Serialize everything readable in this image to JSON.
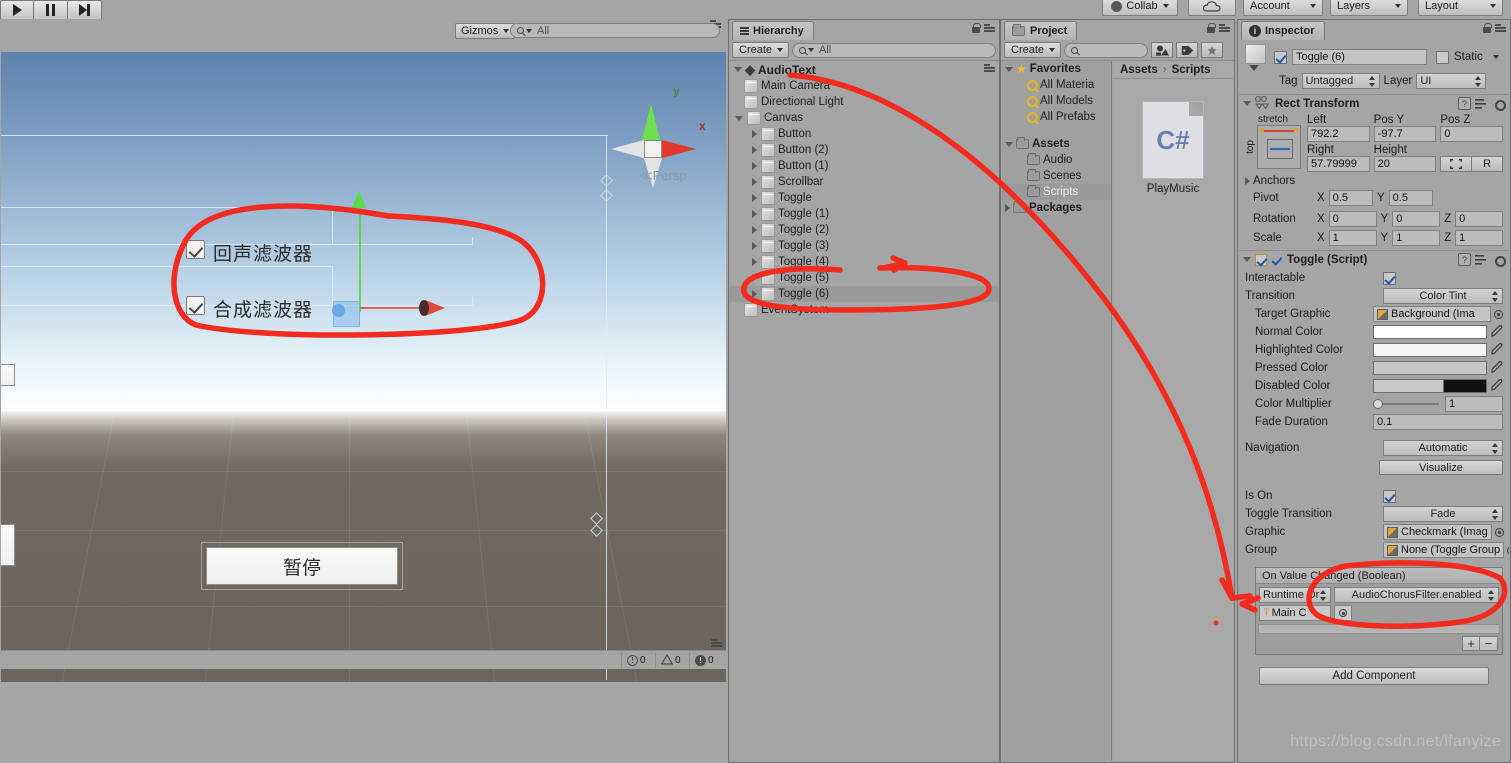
{
  "app": {
    "watermark": "https://blog.csdn.net/lfanyize"
  },
  "toolbar": {
    "collab_label": "Collab",
    "cloud_label": "cloud-icon",
    "account_label": "Account",
    "layers_label": "Layers",
    "layout_label": "Layout",
    "play_label": "play-icon",
    "pause_label": "pause-icon",
    "step_label": "step-icon"
  },
  "scene": {
    "gizmos_label": "Gizmos",
    "search_value": "All",
    "persp_label": "Persp",
    "axis_x": "x",
    "axis_y": "y",
    "ui_labels": [
      "回声滤波器",
      "合成滤波器"
    ],
    "button_label": "暂停",
    "console": {
      "info": "0",
      "warning": "0",
      "error": "0"
    }
  },
  "hierarchy": {
    "tab": "Hierarchy",
    "create_label": "Create",
    "search_value": "All",
    "scene_name": "AudioText",
    "items": [
      {
        "label": "Main Camera",
        "depth": 1,
        "expandable": false,
        "selected": false
      },
      {
        "label": "Directional Light",
        "depth": 1,
        "expandable": false,
        "selected": false
      },
      {
        "label": "Canvas",
        "depth": 1,
        "expandable": true,
        "expanded": true,
        "selected": false
      },
      {
        "label": "Button",
        "depth": 2,
        "expandable": true,
        "selected": false
      },
      {
        "label": "Button (2)",
        "depth": 2,
        "expandable": true,
        "selected": false
      },
      {
        "label": "Button (1)",
        "depth": 2,
        "expandable": true,
        "selected": false
      },
      {
        "label": "Scrollbar",
        "depth": 2,
        "expandable": true,
        "selected": false
      },
      {
        "label": "Toggle",
        "depth": 2,
        "expandable": true,
        "selected": false
      },
      {
        "label": "Toggle (1)",
        "depth": 2,
        "expandable": true,
        "selected": false
      },
      {
        "label": "Toggle (2)",
        "depth": 2,
        "expandable": true,
        "selected": false
      },
      {
        "label": "Toggle (3)",
        "depth": 2,
        "expandable": true,
        "selected": false
      },
      {
        "label": "Toggle (4)",
        "depth": 2,
        "expandable": true,
        "selected": false
      },
      {
        "label": "Toggle (5)",
        "depth": 2,
        "expandable": true,
        "selected": false
      },
      {
        "label": "Toggle (6)",
        "depth": 2,
        "expandable": true,
        "selected": true
      },
      {
        "label": "EventSystem",
        "depth": 1,
        "expandable": false,
        "selected": false
      }
    ]
  },
  "project": {
    "tab": "Project",
    "create_label": "Create",
    "search_value": "",
    "breadcrumb": [
      "Assets",
      "Scripts"
    ],
    "tree": [
      {
        "label": "Favorites",
        "type": "star",
        "depth": 0,
        "expanded": true,
        "bold": true
      },
      {
        "label": "All Materia",
        "type": "lens",
        "depth": 1,
        "bold": false
      },
      {
        "label": "All Models",
        "type": "lens",
        "depth": 1,
        "bold": false
      },
      {
        "label": "All Prefabs",
        "type": "lens",
        "depth": 1,
        "bold": false
      },
      {
        "label": "Assets",
        "type": "folder",
        "depth": 0,
        "expanded": true,
        "bold": true
      },
      {
        "label": "Audio",
        "type": "folder",
        "depth": 1,
        "bold": false
      },
      {
        "label": "Scenes",
        "type": "folder",
        "depth": 1,
        "bold": false
      },
      {
        "label": "Scripts",
        "type": "folder",
        "depth": 1,
        "bold": false,
        "selected": true
      },
      {
        "label": "Packages",
        "type": "folder",
        "depth": 0,
        "expanded": false,
        "bold": true
      }
    ],
    "asset": {
      "name": "PlayMusic",
      "kind": "C#"
    }
  },
  "inspector": {
    "tab": "Inspector",
    "object_name": "Toggle (6)",
    "object_enabled": true,
    "static_label": "Static",
    "static_checked": false,
    "tag_label": "Tag",
    "tag_value": "Untagged",
    "layer_label": "Layer",
    "layer_value": "UI",
    "rect_transform": {
      "title": "Rect Transform",
      "anchor_preset": "stretch",
      "anchor_side": "top",
      "fields": [
        {
          "label": "Left",
          "value": "792.2"
        },
        {
          "label": "Pos Y",
          "value": "-97.7"
        },
        {
          "label": "Pos Z",
          "value": "0"
        },
        {
          "label": "Right",
          "value": "57.79999"
        },
        {
          "label": "Height",
          "value": "20"
        }
      ],
      "blueprint_label": "blueprint-icon",
      "raw_label": "R",
      "anchors_label": "Anchors",
      "pivot_label": "Pivot",
      "pivot_x": "0.5",
      "pivot_y": "0.5",
      "rotation_label": "Rotation",
      "rotation": [
        "0",
        "0",
        "0"
      ],
      "scale_label": "Scale",
      "scale": [
        "1",
        "1",
        "1"
      ],
      "axis_labels": [
        "X",
        "Y",
        "Z"
      ]
    },
    "toggle_script": {
      "title": "Toggle (Script)",
      "enabled": true,
      "rows": [
        {
          "label": "Interactable",
          "kind": "checkbox",
          "value": true
        },
        {
          "label": "Transition",
          "kind": "popup",
          "value": "Color Tint"
        },
        {
          "label": "Target Graphic",
          "kind": "object",
          "value": "Background (Ima"
        },
        {
          "label": "Normal Color",
          "kind": "color",
          "value": "#ffffff"
        },
        {
          "label": "Highlighted Color",
          "kind": "color",
          "value": "#f5f5f5"
        },
        {
          "label": "Pressed Color",
          "kind": "color",
          "value": "#c8c8c8"
        },
        {
          "label": "Disabled Color",
          "kind": "color",
          "value": "#c8c8c8"
        },
        {
          "label": "Color Multiplier",
          "kind": "slider",
          "value": "1"
        },
        {
          "label": "Fade Duration",
          "kind": "text",
          "value": "0.1"
        },
        {
          "label": "Navigation",
          "kind": "popup",
          "value": "Automatic"
        }
      ],
      "visualize_label": "Visualize",
      "rows2": [
        {
          "label": "Is On",
          "kind": "checkbox",
          "value": true
        },
        {
          "label": "Toggle Transition",
          "kind": "popup",
          "value": "Fade"
        },
        {
          "label": "Graphic",
          "kind": "object",
          "value": "Checkmark (Imag"
        },
        {
          "label": "Group",
          "kind": "object",
          "value": "None (Toggle Group"
        }
      ],
      "event": {
        "title": "On Value Changed (Boolean)",
        "mode": "Runtime Or",
        "method": "AudioChorusFilter.enabled",
        "target": "Main C",
        "add_label": "+",
        "remove_label": "−"
      }
    },
    "add_component_label": "Add Component"
  }
}
